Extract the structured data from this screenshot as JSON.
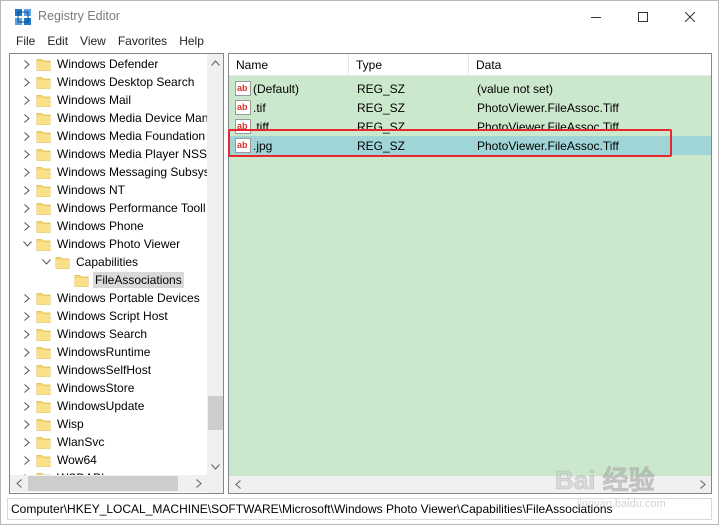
{
  "window": {
    "title": "Registry Editor",
    "icon": "registry-icon"
  },
  "menu": [
    "File",
    "Edit",
    "View",
    "Favorites",
    "Help"
  ],
  "tree": [
    {
      "label": "Windows Defender",
      "level": 0,
      "expander": "collapsed"
    },
    {
      "label": "Windows Desktop Search",
      "level": 0,
      "expander": "collapsed"
    },
    {
      "label": "Windows Mail",
      "level": 0,
      "expander": "collapsed"
    },
    {
      "label": "Windows Media Device Man",
      "level": 0,
      "expander": "collapsed"
    },
    {
      "label": "Windows Media Foundation",
      "level": 0,
      "expander": "collapsed"
    },
    {
      "label": "Windows Media Player NSS",
      "level": 0,
      "expander": "collapsed"
    },
    {
      "label": "Windows Messaging Subsys",
      "level": 0,
      "expander": "collapsed"
    },
    {
      "label": "Windows NT",
      "level": 0,
      "expander": "collapsed"
    },
    {
      "label": "Windows Performance Tooll",
      "level": 0,
      "expander": "collapsed"
    },
    {
      "label": "Windows Phone",
      "level": 0,
      "expander": "collapsed"
    },
    {
      "label": "Windows Photo Viewer",
      "level": 0,
      "expander": "expanded"
    },
    {
      "label": "Capabilities",
      "level": 1,
      "expander": "expanded"
    },
    {
      "label": "FileAssociations",
      "level": 2,
      "expander": "none",
      "selected": true
    },
    {
      "label": "Windows Portable Devices",
      "level": 0,
      "expander": "collapsed"
    },
    {
      "label": "Windows Script Host",
      "level": 0,
      "expander": "collapsed"
    },
    {
      "label": "Windows Search",
      "level": 0,
      "expander": "collapsed"
    },
    {
      "label": "WindowsRuntime",
      "level": 0,
      "expander": "collapsed"
    },
    {
      "label": "WindowsSelfHost",
      "level": 0,
      "expander": "collapsed"
    },
    {
      "label": "WindowsStore",
      "level": 0,
      "expander": "collapsed"
    },
    {
      "label": "WindowsUpdate",
      "level": 0,
      "expander": "collapsed"
    },
    {
      "label": "Wisp",
      "level": 0,
      "expander": "collapsed"
    },
    {
      "label": "WlanSvc",
      "level": 0,
      "expander": "collapsed"
    },
    {
      "label": "Wow64",
      "level": 0,
      "expander": "collapsed"
    },
    {
      "label": "WSDAPI",
      "level": 0,
      "expander": "collapsed"
    }
  ],
  "list": {
    "columns": [
      "Name",
      "Type",
      "Data"
    ],
    "rows": [
      {
        "name": "(Default)",
        "type": "REG_SZ",
        "data": "(value not set)",
        "icon": "string-value-icon"
      },
      {
        "name": ".tif",
        "type": "REG_SZ",
        "data": "PhotoViewer.FileAssoc.Tiff",
        "icon": "string-value-icon"
      },
      {
        "name": ".tiff",
        "type": "REG_SZ",
        "data": "PhotoViewer.FileAssoc.Tiff",
        "icon": "string-value-icon"
      },
      {
        "name": ".jpg",
        "type": "REG_SZ",
        "data": "PhotoViewer.FileAssoc.Tiff",
        "icon": "string-value-icon",
        "selected": true
      }
    ]
  },
  "status": {
    "path": "Computer\\HKEY_LOCAL_MACHINE\\SOFTWARE\\Microsoft\\Windows Photo Viewer\\Capabilities\\FileAssociations"
  },
  "watermark": {
    "text": "Bai 经验",
    "subtext": "jingyan.baidu.com"
  },
  "colors": {
    "list_background": "#cce8cc",
    "selection": "#9fd5d6",
    "highlight_border": "#e8262d",
    "folder": "#f8d775"
  }
}
